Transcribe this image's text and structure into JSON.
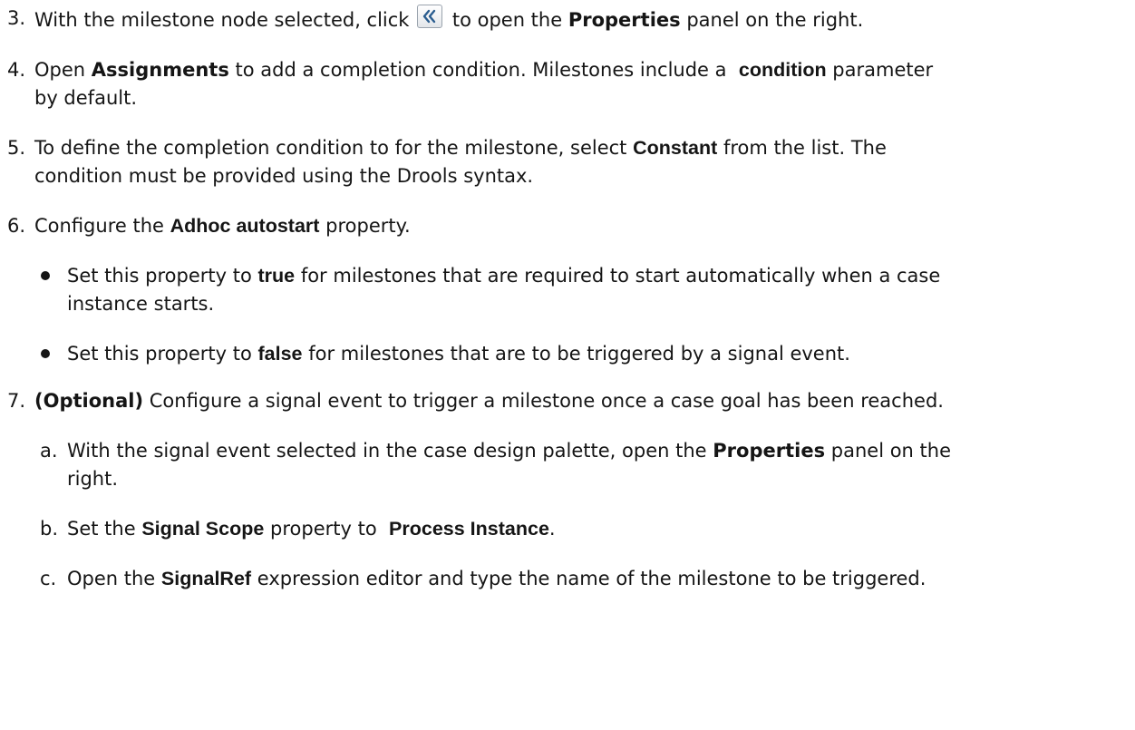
{
  "steps": {
    "s3": {
      "num": "3.",
      "pre": "With the milestone node selected, click",
      "post": "to open the",
      "kw1": "Properties",
      "tail": "panel on the right.",
      "icon": "double-chevron-left-icon"
    },
    "s4": {
      "num": "4.",
      "pre": "Open",
      "kw1": "Assignments",
      "mid": "to add a completion condition. Milestones include a",
      "kw2": "condition",
      "tail": "parameter",
      "line2": "by default."
    },
    "s5": {
      "num": "5.",
      "pre": "To define the completion condition to for the milestone, select",
      "kw1": "Constant",
      "tail": "from the list. The",
      "line2": "condition must be provided using the Drools syntax."
    },
    "s6": {
      "num": "6.",
      "pre": "Configure the",
      "kw1": "Adhoc autostart",
      "tail": "property.",
      "bullets": [
        {
          "pre": "Set this property to",
          "kw": "true",
          "tail": "for milestones that are required to start automatically when a case",
          "line2": "instance starts."
        },
        {
          "pre": "Set this property to",
          "kw": "false",
          "tail": "for milestones that are to be triggered by a signal event."
        }
      ]
    },
    "s7": {
      "num": "7.",
      "kw1": "(Optional)",
      "tail": "Configure a signal event to trigger a milestone once a case goal has been reached.",
      "subs": {
        "a": {
          "num": "a.",
          "pre": "With the signal event selected in the case design palette, open the",
          "kw": "Properties",
          "tail": "panel on the",
          "line2": "right."
        },
        "b": {
          "num": "b.",
          "pre": "Set the",
          "kw1": "Signal Scope",
          "mid": "property to",
          "kw2": "Process Instance",
          "tail": "."
        },
        "c": {
          "num": "c.",
          "pre": "Open the",
          "kw": "SignalRef",
          "tail": "expression editor and type the name of the milestone to be triggered."
        }
      }
    }
  }
}
